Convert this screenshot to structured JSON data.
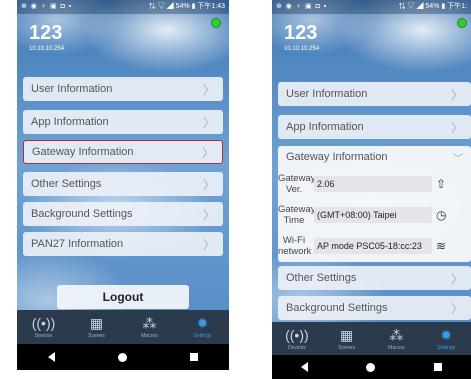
{
  "status": {
    "left_icons": "⊕ ◉ ♀ ▣ ◘ ▪",
    "right_text_left": "⇅ ▽ ◢ 54% ▮ 下午1:43",
    "right_text_right": "⇅ ▽ ◢ 54% ▮ 下午1:"
  },
  "header": {
    "name": "123",
    "ip_left": "10.10.10.254",
    "ip_right": "10.10.10.254"
  },
  "left_menu": [
    {
      "label": "User Information"
    },
    {
      "label": "App Information"
    },
    {
      "label": "Gateway Information"
    },
    {
      "label": "Other Settings"
    },
    {
      "label": "Background Settings"
    },
    {
      "label": "PAN27 Information"
    }
  ],
  "logout_label": "Logout",
  "tabs": [
    {
      "label": "Devices",
      "icon": "devices-icon",
      "glyph": "((•))"
    },
    {
      "label": "Scenes",
      "icon": "scenes-icon",
      "glyph": "▦"
    },
    {
      "label": "Macros",
      "icon": "macros-icon",
      "glyph": "⁂"
    },
    {
      "label": "Settings",
      "icon": "gear-icon",
      "glyph": "✹"
    }
  ],
  "right_menu": {
    "user": "User Information",
    "app": "App Information",
    "gateway": "Gateway Information",
    "other": "Other Settings",
    "background": "Background Settings"
  },
  "gateway": {
    "ver_label": "Gateway Ver.",
    "ver_value": "2.06",
    "time_label": "Gateway Time",
    "time_value": "(GMT+08:00) Taipei",
    "wifi_label": "Wi-Fi network",
    "wifi_value": "AP mode PSC05-18:cc:23"
  },
  "colors": {
    "accent": "#3a9ae8",
    "selected_border": "#c0283a",
    "status_dot": "#33cc33"
  }
}
